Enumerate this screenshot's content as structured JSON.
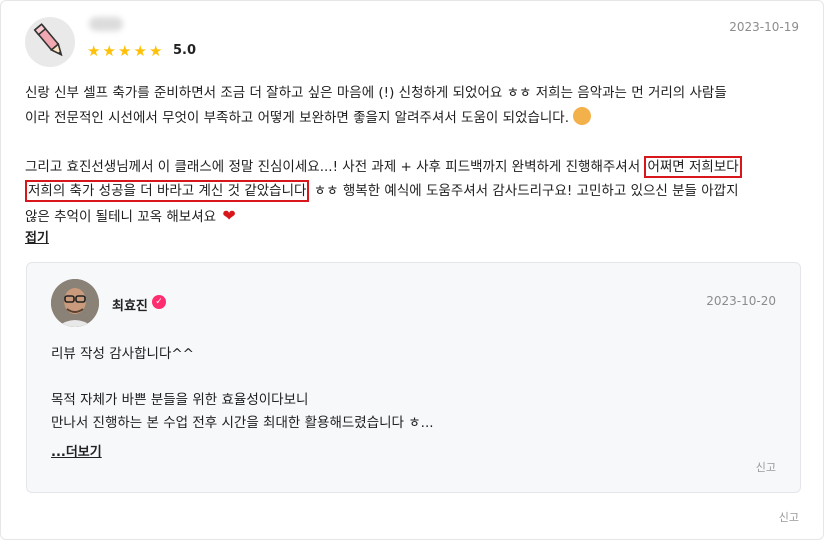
{
  "review": {
    "date": "2023-10-19",
    "rating_value": 5,
    "rating_text": "5.0",
    "lines": [
      "신랑 신부 셀프 축가를 준비하면서 조금 더 잘하고 싶은 마음에 (!) 신청하게 되었어요 ㅎㅎ 저희는 음악과는 먼 거리의 사람들",
      "이라 전문적인 시선에서 무엇이 부족하고 어떻게 보완하면 좋을지 알려주셔서 도움이 되었습니다."
    ],
    "para2": {
      "line1_pre": "그리고 효진선생님께서 이 클래스에 정말 진심이세요...! 사전 과제 + 사후 피드백까지 완벽하게 진행해주셔서 ",
      "line1_hl": "어쩌면 저희보다",
      "line2_hl": "저희의 축가 성공을 더 바라고 계신 것 같았습니다",
      "line2_post": " ㅎㅎ 행복한 예식에 도움주셔서 감사드리구요! 고민하고 있으신 분들 아깝지",
      "line3": "않은 추억이 될테니 꼬옥 해보셔요"
    },
    "fold_label": "접기",
    "report_label": "신고"
  },
  "reply": {
    "author": "최효진",
    "date": "2023-10-20",
    "lines": [
      "리뷰 작성 감사합니다^^",
      "",
      "목적 자체가 바쁜 분들을 위한 효율성이다보니",
      "만나서 진행하는 본 수업 전후 시간을 최대한 활용해드렸습니다 ㅎ..."
    ],
    "more_label": "...더보기",
    "report_label": "신고"
  },
  "icons": {
    "reviewer_avatar": "pencil-icon",
    "verified": "check-badge-icon",
    "emoji": "smiling-face-icon",
    "heart": "heart-icon"
  },
  "colors": {
    "star": "#ffc107",
    "highlight_border": "#d8171d",
    "verified_badge": "#ff2d6f",
    "reply_bg": "#f7f8fa"
  }
}
